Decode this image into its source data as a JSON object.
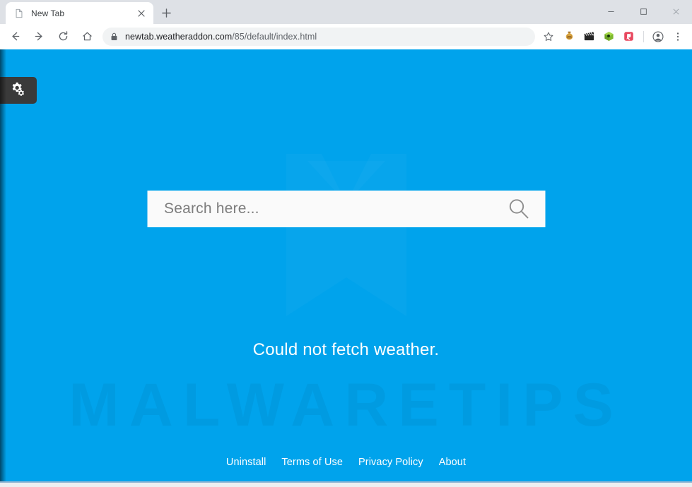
{
  "browser": {
    "tab": {
      "title": "New Tab",
      "favicon_icon": "page-icon",
      "close_icon": "close-icon"
    },
    "new_tab_icon": "plus-icon",
    "window_controls": {
      "minimize_icon": "minimize-icon",
      "maximize_icon": "maximize-icon",
      "close_icon": "close-icon"
    },
    "toolbar": {
      "back_icon": "arrow-left-icon",
      "forward_icon": "arrow-right-icon",
      "reload_icon": "reload-icon",
      "home_icon": "home-icon",
      "lock_icon": "lock-icon",
      "url_host": "newtab.weatheraddon.com",
      "url_path": "/85/default/index.html",
      "url_full": "newtab.weatheraddon.com/85/default/index.html",
      "bookmark_icon": "star-icon",
      "extensions": [
        {
          "name": "honey-extension-icon",
          "color": "#d9a441"
        },
        {
          "name": "film-clapper-extension-icon",
          "color": "#2b2b2b"
        },
        {
          "name": "green-cube-extension-icon",
          "color": "#8cc63f"
        },
        {
          "name": "red-square-extension-icon",
          "color": "#e8485f"
        }
      ],
      "profile_icon": "account-circle-icon",
      "menu_icon": "more-vertical-icon"
    }
  },
  "page": {
    "background_color": "#00a3ec",
    "watermark_text": "MALWARETIPS",
    "settings": {
      "gear_icon": "gear-icon",
      "gear_small_icon": "gear-small-icon"
    },
    "search": {
      "placeholder": "Search here...",
      "value": "",
      "submit_icon": "search-icon"
    },
    "weather_message": "Could not fetch weather.",
    "footer_links": [
      {
        "label": "Uninstall"
      },
      {
        "label": "Terms of Use"
      },
      {
        "label": "Privacy Policy"
      },
      {
        "label": "About"
      }
    ]
  }
}
